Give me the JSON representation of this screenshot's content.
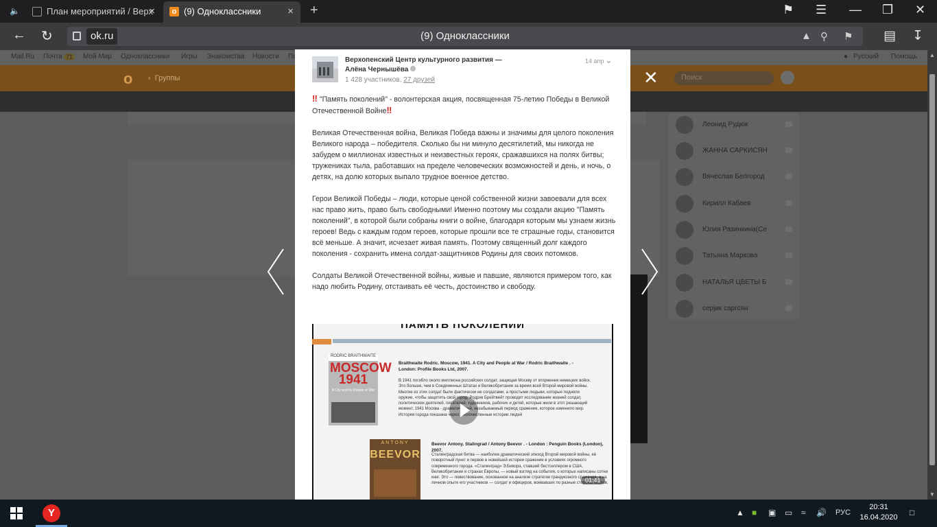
{
  "browser": {
    "tabs": [
      {
        "title": "План мероприятий / Верх",
        "active": false
      },
      {
        "title": "(9) Одноклассники",
        "active": true
      }
    ],
    "new_tab": "+",
    "url": "ok.ru",
    "page_title": "(9) Одноклассники",
    "icons": [
      "back-icon",
      "reload-icon",
      "lock-icon",
      "bookmarks-icon",
      "menu-icon",
      "minimize-icon",
      "restore-icon",
      "close-icon",
      "download-icon",
      "translate-icon"
    ]
  },
  "background_page": {
    "portal_links": [
      "Mail.Ru",
      "Почта",
      "Мой Мир",
      "Одноклассники",
      "Игры",
      "Знакомства",
      "Новости",
      "Пои"
    ],
    "mail_count": "71",
    "language": "Русский",
    "help": "Помощь",
    "breadcrumb": "Группы",
    "search_placeholder": "Поиск",
    "friends": [
      "Леонид Рудюк",
      "ЖАННА САРКИСЯН",
      "Вячеслав Белгород",
      "Кирилл Кабаев",
      "Юлия Разинкина(Се",
      "Татьяна Маркова",
      "НАТАЛЬЯ ЦВЕТЫ Б",
      "серjик саргсян"
    ]
  },
  "post": {
    "group_name": "Верхопенский Центр культурного развития —",
    "author": "Алёна Чернышёва",
    "members": "1 428 участников",
    "friends": "27 друзей",
    "date": "14 апр",
    "headline": "\"Память поколений\" - волонтерская акция, посвященная 75-летию Победы в Великой Отечественной Войне",
    "paragraph_1": "Великая Отечественная война, Великая Победа важны и значимы для целого поколения Великого народа – победителя. Сколько бы ни минуло десятилетий, мы никогда не забудем о миллионах известных и неизвестных героях, сражавшихся на полях битвы;",
    "paragraph_1b": "тружениках тыла, работавших на пределе человеческих возможностей и день, и ночь, о детях, на долю которых выпало трудное военное детство.",
    "paragraph_2": "Герои Великой Победы – люди, которые ценой собственной жизни завоевали для всех нас право жить, право быть свободными! Именно поэтому мы создали акцию \"Память поколений\", в которой были собраны книги о войне, благодаря которым мы узнаем жизнь героев! Ведь с каждым годом героев, которые прошли все те страшные годы, становится всё меньше. А значит, исчезает живая память. Поэтому священный долг каждого поколения - сохранить имена солдат-защитников Родины для своих потомков.",
    "paragraph_3": "Солдаты Великой Отечественной войны, живые и павшие, являются примером того, как надо любить Родину, отстаивать её честь, достоинство и свободу."
  },
  "video": {
    "title": "ПАМЯТЬ ПОКОЛЕНИЙ",
    "book1_author": "RODRIC BRAITHWAITE",
    "book1_cover": "MOSCOW 1941",
    "book1_caption": "A City and Its People at War",
    "book1_ref": "Braithwaite Rodric. Moscow, 1941. A City and People at War / Rodric Braithwaite . - London: Profile Books Ltd, 2007.",
    "book1_text": "В 1941 погибло около миллиона российских солдат, защищая Москву от вторжения немецких войск. Это больше, чем в Соединенных Штатах и Великобритании за время всей Второй мировой войны. Многие из этих солдат были фактически не солдатами, а простыми людьми, которые подняли оружие, чтобы защитить свой город. Родрик Брейтвейт проводит исследование жизней солдат, политических деятелей, писателей, художников, рабочих и детей, которые жили в этот решающий момент. 1941 Москва - драматический, незабываемый период сражения, которое изменило мир. История города показана через многочисленные истории людей",
    "book2_author": "ANTONY",
    "book2_cover": "BEEVOR",
    "book2_ref": "Beevor Antony. Stalingrad / Antony Beevor . - London : Penguin Books (London), 2007.",
    "book2_text": "Сталинградская битва — наиболее драматический эпизод Второй мировой войны, её поворотный пункт и первое в новейшей истории сражение в условиях огромного современного города. «Сталинград» Э.Бивора, ставший бестселлером в США, Великобритании и странах Европы, — новый взгляд на события, о которых написаны сотни книг. Это — повествование, основанное на анализе стратегии грандиозного сражения, а на личном опыте его участников — солдат и офицеров, воевавших по разные стороны окопов.",
    "duration": "01:41"
  },
  "taskbar": {
    "language": "РУС",
    "time": "20:31",
    "date": "16.04.2020"
  },
  "colors": {
    "ok_orange": "#f28b1e",
    "yandex_red": "#e52620",
    "taskbar": "#101820"
  }
}
